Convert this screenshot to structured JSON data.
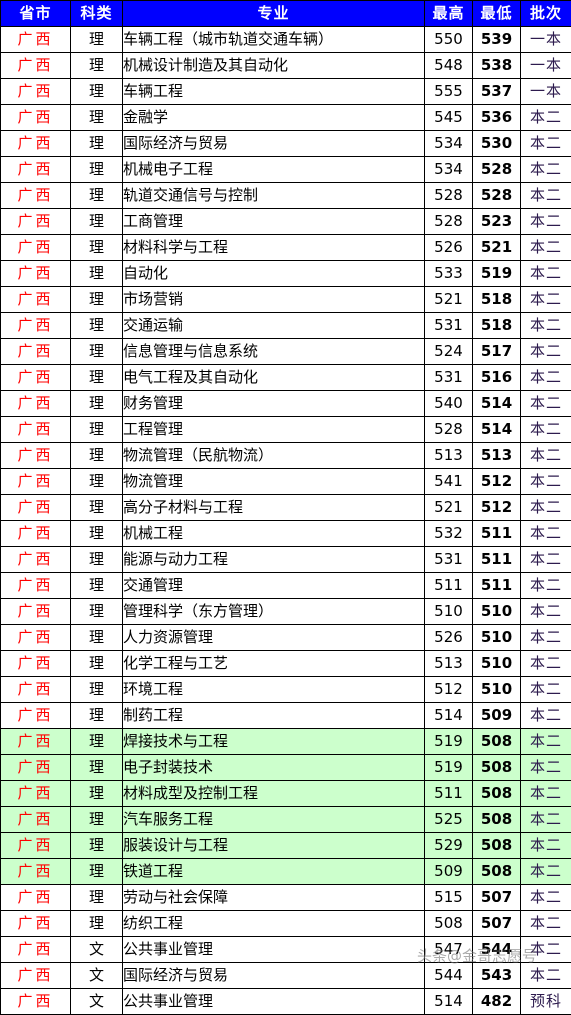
{
  "table": {
    "headers": {
      "province": "省市",
      "category": "科类",
      "major": "专业",
      "high": "最高",
      "low": "最低",
      "batch": "批次"
    },
    "rows": [
      {
        "province": "广西",
        "category": "理",
        "major": "车辆工程（城市轨道交通车辆）",
        "high": "550",
        "low": "539",
        "batch": "一本",
        "highlight": false
      },
      {
        "province": "广西",
        "category": "理",
        "major": "机械设计制造及其自动化",
        "high": "548",
        "low": "538",
        "batch": "一本",
        "highlight": false
      },
      {
        "province": "广西",
        "category": "理",
        "major": "车辆工程",
        "high": "555",
        "low": "537",
        "batch": "一本",
        "highlight": false
      },
      {
        "province": "广西",
        "category": "理",
        "major": "金融学",
        "high": "545",
        "low": "536",
        "batch": "本二",
        "highlight": false
      },
      {
        "province": "广西",
        "category": "理",
        "major": "国际经济与贸易",
        "high": "534",
        "low": "530",
        "batch": "本二",
        "highlight": false
      },
      {
        "province": "广西",
        "category": "理",
        "major": "机械电子工程",
        "high": "534",
        "low": "528",
        "batch": "本二",
        "highlight": false
      },
      {
        "province": "广西",
        "category": "理",
        "major": "轨道交通信号与控制",
        "high": "528",
        "low": "528",
        "batch": "本二",
        "highlight": false
      },
      {
        "province": "广西",
        "category": "理",
        "major": "工商管理",
        "high": "528",
        "low": "523",
        "batch": "本二",
        "highlight": false
      },
      {
        "province": "广西",
        "category": "理",
        "major": "材料科学与工程",
        "high": "526",
        "low": "521",
        "batch": "本二",
        "highlight": false
      },
      {
        "province": "广西",
        "category": "理",
        "major": "自动化",
        "high": "533",
        "low": "519",
        "batch": "本二",
        "highlight": false
      },
      {
        "province": "广西",
        "category": "理",
        "major": "市场营销",
        "high": "521",
        "low": "518",
        "batch": "本二",
        "highlight": false
      },
      {
        "province": "广西",
        "category": "理",
        "major": "交通运输",
        "high": "531",
        "low": "518",
        "batch": "本二",
        "highlight": false
      },
      {
        "province": "广西",
        "category": "理",
        "major": "信息管理与信息系统",
        "high": "524",
        "low": "517",
        "batch": "本二",
        "highlight": false
      },
      {
        "province": "广西",
        "category": "理",
        "major": "电气工程及其自动化",
        "high": "531",
        "low": "516",
        "batch": "本二",
        "highlight": false
      },
      {
        "province": "广西",
        "category": "理",
        "major": "财务管理",
        "high": "540",
        "low": "514",
        "batch": "本二",
        "highlight": false
      },
      {
        "province": "广西",
        "category": "理",
        "major": "工程管理",
        "high": "528",
        "low": "514",
        "batch": "本二",
        "highlight": false
      },
      {
        "province": "广西",
        "category": "理",
        "major": "物流管理（民航物流）",
        "high": "513",
        "low": "513",
        "batch": "本二",
        "highlight": false
      },
      {
        "province": "广西",
        "category": "理",
        "major": "物流管理",
        "high": "541",
        "low": "512",
        "batch": "本二",
        "highlight": false
      },
      {
        "province": "广西",
        "category": "理",
        "major": "高分子材料与工程",
        "high": "521",
        "low": "512",
        "batch": "本二",
        "highlight": false
      },
      {
        "province": "广西",
        "category": "理",
        "major": "机械工程",
        "high": "532",
        "low": "511",
        "batch": "本二",
        "highlight": false
      },
      {
        "province": "广西",
        "category": "理",
        "major": "能源与动力工程",
        "high": "531",
        "low": "511",
        "batch": "本二",
        "highlight": false
      },
      {
        "province": "广西",
        "category": "理",
        "major": "交通管理",
        "high": "511",
        "low": "511",
        "batch": "本二",
        "highlight": false
      },
      {
        "province": "广西",
        "category": "理",
        "major": "管理科学（东方管理）",
        "high": "510",
        "low": "510",
        "batch": "本二",
        "highlight": false
      },
      {
        "province": "广西",
        "category": "理",
        "major": "人力资源管理",
        "high": "526",
        "low": "510",
        "batch": "本二",
        "highlight": false
      },
      {
        "province": "广西",
        "category": "理",
        "major": "化学工程与工艺",
        "high": "513",
        "low": "510",
        "batch": "本二",
        "highlight": false
      },
      {
        "province": "广西",
        "category": "理",
        "major": "环境工程",
        "high": "512",
        "low": "510",
        "batch": "本二",
        "highlight": false
      },
      {
        "province": "广西",
        "category": "理",
        "major": "制药工程",
        "high": "514",
        "low": "509",
        "batch": "本二",
        "highlight": false
      },
      {
        "province": "广西",
        "category": "理",
        "major": "焊接技术与工程",
        "high": "519",
        "low": "508",
        "batch": "本二",
        "highlight": true
      },
      {
        "province": "广西",
        "category": "理",
        "major": "电子封装技术",
        "high": "519",
        "low": "508",
        "batch": "本二",
        "highlight": true
      },
      {
        "province": "广西",
        "category": "理",
        "major": "材料成型及控制工程",
        "high": "511",
        "low": "508",
        "batch": "本二",
        "highlight": true
      },
      {
        "province": "广西",
        "category": "理",
        "major": "汽车服务工程",
        "high": "525",
        "low": "508",
        "batch": "本二",
        "highlight": true
      },
      {
        "province": "广西",
        "category": "理",
        "major": "服装设计与工程",
        "high": "529",
        "low": "508",
        "batch": "本二",
        "highlight": true
      },
      {
        "province": "广西",
        "category": "理",
        "major": "铁道工程",
        "high": "509",
        "low": "508",
        "batch": "本二",
        "highlight": true
      },
      {
        "province": "广西",
        "category": "理",
        "major": "劳动与社会保障",
        "high": "515",
        "low": "507",
        "batch": "本二",
        "highlight": false
      },
      {
        "province": "广西",
        "category": "理",
        "major": "纺织工程",
        "high": "508",
        "low": "507",
        "batch": "本二",
        "highlight": false
      },
      {
        "province": "广西",
        "category": "文",
        "major": "公共事业管理",
        "high": "547",
        "low": "544",
        "batch": "本二",
        "highlight": false
      },
      {
        "province": "广西",
        "category": "文",
        "major": "国际经济与贸易",
        "high": "544",
        "low": "543",
        "batch": "本二",
        "highlight": false
      },
      {
        "province": "广西",
        "category": "文",
        "major": "公共事业管理",
        "high": "514",
        "low": "482",
        "batch": "预科",
        "highlight": false
      }
    ]
  },
  "watermark": {
    "text": "头条@金哥志愿号"
  },
  "colors": {
    "header_background": "#0000FF",
    "header_text": "#FFFFFF",
    "province_text": "#FF0000",
    "highlight_row": "#CCFFCC",
    "border": "#000000"
  }
}
